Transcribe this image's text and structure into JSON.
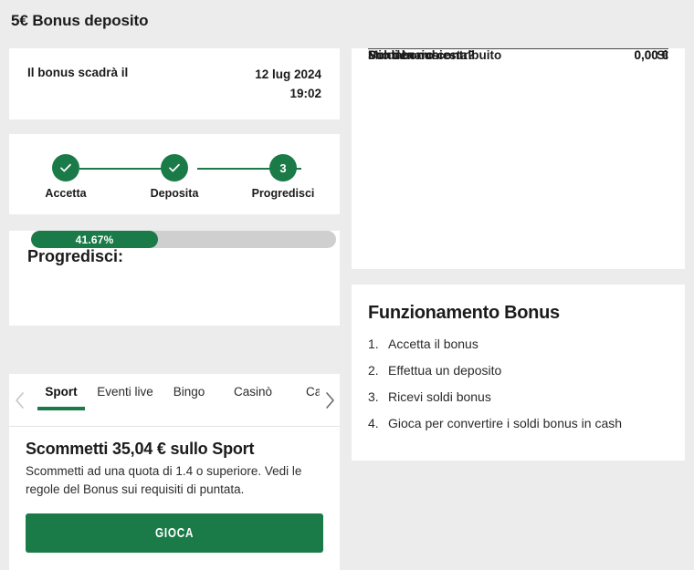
{
  "page": {
    "title": "5€ Bonus deposito",
    "background_color": "#ececec",
    "accent_color": "#1a7a48"
  },
  "expiry_card": {
    "label": "Il bonus scadrà il",
    "date": "12 lug 2024",
    "time": "19:02"
  },
  "stepper": {
    "steps": [
      {
        "label": "Accetta",
        "marker": "check",
        "state": "done"
      },
      {
        "label": "Deposita",
        "marker": "check",
        "state": "done"
      },
      {
        "label": "Progredisci",
        "marker": "3",
        "state": "current"
      }
    ]
  },
  "progress_card": {
    "title": "Progredisci:",
    "percent_label": "41.67%",
    "percent_value": 41.67,
    "track_color": "#cfcfcf",
    "fill_color": "#1a7a48"
  },
  "bet_card": {
    "tabs": [
      {
        "label": "Sport",
        "active": true
      },
      {
        "label": "Eventi live",
        "active": false
      },
      {
        "label": "Bingo",
        "active": false
      },
      {
        "label": "Casinò",
        "active": false
      },
      {
        "label": "Ca l",
        "active": false
      }
    ],
    "prev_arrow_icon": "chevron-left-icon",
    "next_arrow_icon": "chevron-right-icon",
    "title": "Scommetti 35,04 € sullo Sport",
    "description": "Scommetti ad una quota di 1.4 o superiore. Vedi le regole del Bonus sui requisiti di puntata.",
    "play_button": "GIOCA"
  },
  "summary_card": {
    "rows": [
      {
        "label": "Mio denaro contribuito",
        "value": "0,00 €"
      },
      {
        "label": "Soldi bonus",
        "value": "0,00 €"
      },
      {
        "label": "Puntata richiesta?",
        "value": "Sì"
      }
    ]
  },
  "how_card": {
    "title": "Funzionamento Bonus",
    "items": [
      {
        "num": "1.",
        "text": "Accetta il bonus"
      },
      {
        "num": "2.",
        "text": "Effettua un deposito"
      },
      {
        "num": "3.",
        "text": "Ricevi soldi bonus"
      },
      {
        "num": "4.",
        "text": "Gioca per convertire i soldi bonus in cash"
      }
    ]
  }
}
